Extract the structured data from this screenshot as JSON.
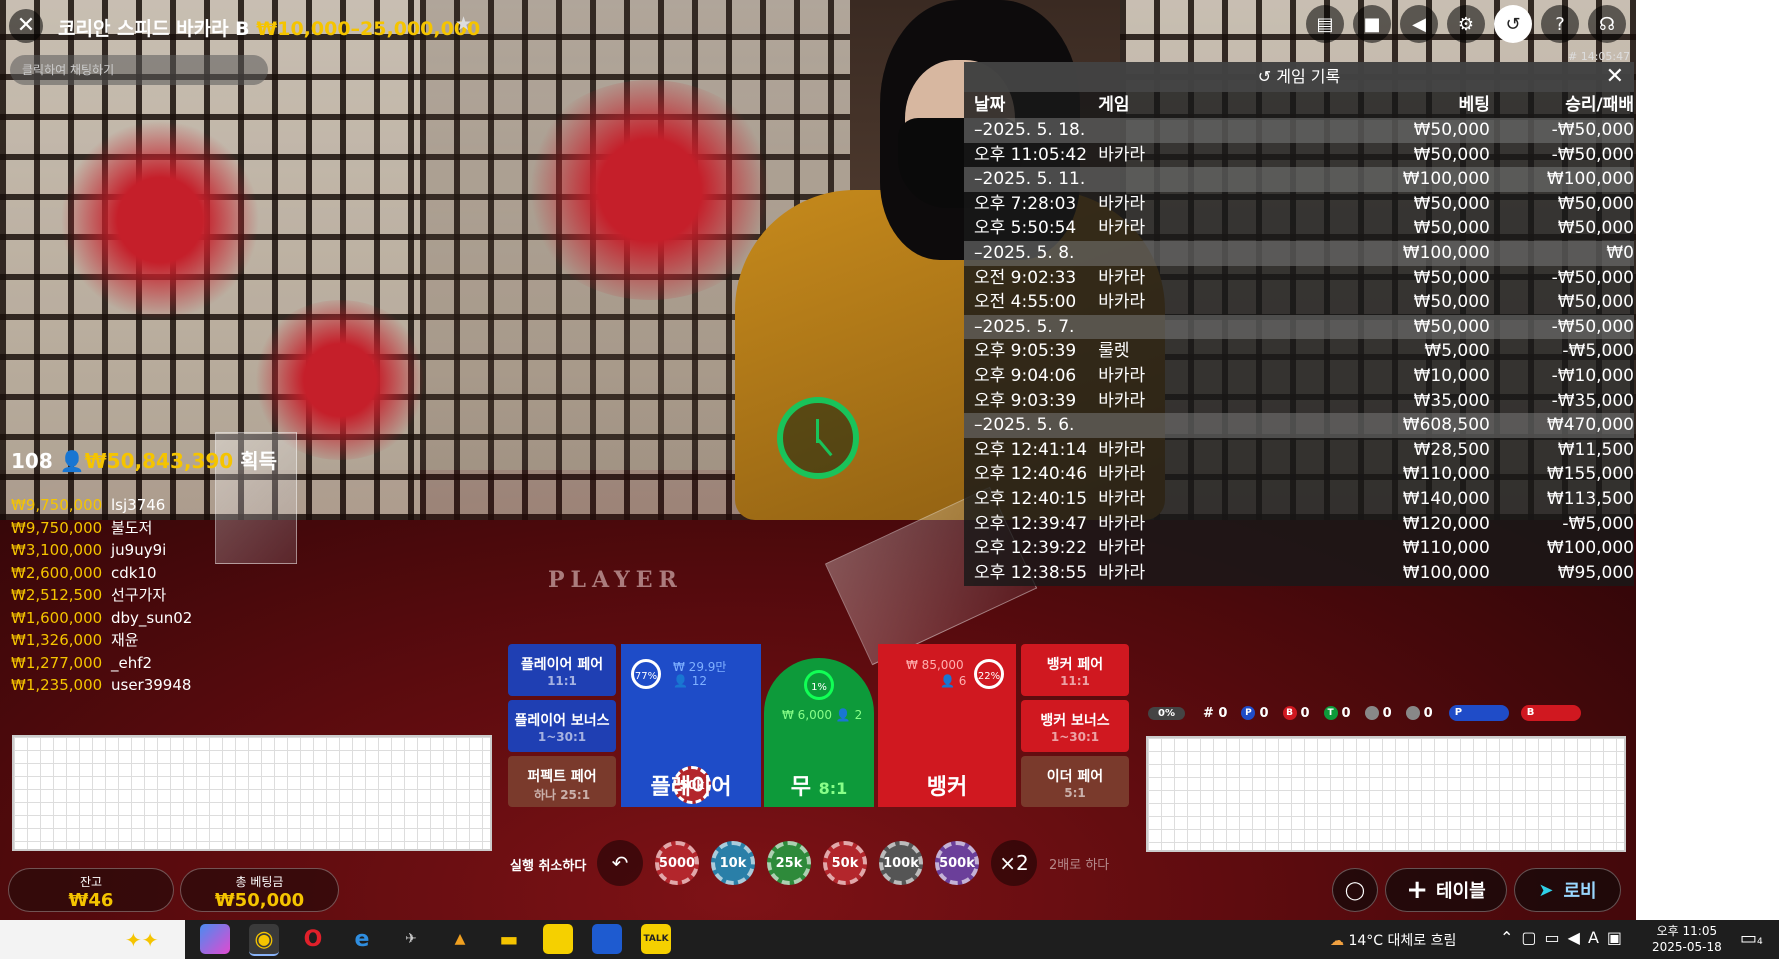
{
  "header": {
    "close_icon": "close-icon",
    "title": "코리안 스피드 바카라 B",
    "limits": "₩10,000–25,000,000",
    "chat_placeholder": "클릭하여 채팅하기",
    "clock": "# 14:05:47",
    "icons": [
      "chat-icon",
      "video-icon",
      "volume-icon",
      "gear-icon",
      "history-icon",
      "help-icon",
      "headset-icon"
    ]
  },
  "history": {
    "title": "게임 기록",
    "columns": [
      "날짜",
      "게임",
      "베팅",
      "승리/패배"
    ],
    "rows": [
      {
        "date": "–2025. 5. 18.",
        "game": "",
        "bet": "₩50,000",
        "result": "-₩50,000",
        "group": true
      },
      {
        "date": "오후 11:05:42",
        "game": "바카라",
        "bet": "₩50,000",
        "result": "-₩50,000"
      },
      {
        "date": "–2025. 5. 11.",
        "game": "",
        "bet": "₩100,000",
        "result": "₩100,000",
        "group": true
      },
      {
        "date": "오후 7:28:03",
        "game": "바카라",
        "bet": "₩50,000",
        "result": "₩50,000"
      },
      {
        "date": "오후 5:50:54",
        "game": "바카라",
        "bet": "₩50,000",
        "result": "₩50,000"
      },
      {
        "date": "–2025. 5. 8.",
        "game": "",
        "bet": "₩100,000",
        "result": "₩0",
        "group": true
      },
      {
        "date": "오전 9:02:33",
        "game": "바카라",
        "bet": "₩50,000",
        "result": "-₩50,000"
      },
      {
        "date": "오전 4:55:00",
        "game": "바카라",
        "bet": "₩50,000",
        "result": "₩50,000"
      },
      {
        "date": "–2025. 5. 7.",
        "game": "",
        "bet": "₩50,000",
        "result": "-₩50,000",
        "group": true
      },
      {
        "date": "오후 9:05:39",
        "game": "룰렛",
        "bet": "₩5,000",
        "result": "-₩5,000"
      },
      {
        "date": "오후 9:04:06",
        "game": "바카라",
        "bet": "₩10,000",
        "result": "-₩10,000"
      },
      {
        "date": "오후 9:03:39",
        "game": "바카라",
        "bet": "₩35,000",
        "result": "-₩35,000"
      },
      {
        "date": "–2025. 5. 6.",
        "game": "",
        "bet": "₩608,500",
        "result": "₩470,000",
        "group": true
      },
      {
        "date": "오후 12:41:14",
        "game": "바카라",
        "bet": "₩28,500",
        "result": "₩11,500"
      },
      {
        "date": "오후 12:40:46",
        "game": "바카라",
        "bet": "₩110,000",
        "result": "₩155,000"
      },
      {
        "date": "오후 12:40:15",
        "game": "바카라",
        "bet": "₩140,000",
        "result": "₩113,500"
      },
      {
        "date": "오후 12:39:47",
        "game": "바카라",
        "bet": "₩120,000",
        "result": "-₩5,000"
      },
      {
        "date": "오후 12:39:22",
        "game": "바카라",
        "bet": "₩110,000",
        "result": "₩100,000"
      },
      {
        "date": "오후 12:38:55",
        "game": "바카라",
        "bet": "₩100,000",
        "result": "₩95,000"
      }
    ]
  },
  "scene": {
    "table_label": "PLAYER"
  },
  "winners": {
    "count": "108",
    "total": "₩50,843,390",
    "suffix": "획득",
    "list": [
      {
        "amount": "₩9,750,000",
        "name": "lsj3746"
      },
      {
        "amount": "₩9,750,000",
        "name": "불도저"
      },
      {
        "amount": "₩3,100,000",
        "name": "ju9uy9i"
      },
      {
        "amount": "₩2,600,000",
        "name": "cdk10"
      },
      {
        "amount": "₩2,512,500",
        "name": "선구가자"
      },
      {
        "amount": "₩1,600,000",
        "name": "dby_sun02"
      },
      {
        "amount": "₩1,326,000",
        "name": "재윤"
      },
      {
        "amount": "₩1,277,000",
        "name": "_ehf2"
      },
      {
        "amount": "₩1,235,000",
        "name": "user39948"
      }
    ]
  },
  "bets": {
    "player_pair": {
      "label": "플레이어 페어",
      "odds": "11:1"
    },
    "player_bonus": {
      "label": "플레이어 보너스",
      "odds": "1~30:1"
    },
    "perfect_pair": {
      "label": "퍼펙트 페어",
      "odds": "하나 25:1"
    },
    "banker_pair": {
      "label": "뱅커 페어",
      "odds": "11:1"
    },
    "banker_bonus": {
      "label": "뱅커 보너스",
      "odds": "1~30:1"
    },
    "either_pair": {
      "label": "이더 페어",
      "odds": "5:1"
    },
    "player": {
      "label": "플레이어",
      "pct": "77%",
      "amount": "₩ 29.9만",
      "players": "12",
      "chip": "50k"
    },
    "tie": {
      "label": "무",
      "odds": "8:1",
      "pct": "1%",
      "amount": "₩ 6,000",
      "players": "2"
    },
    "banker": {
      "label": "뱅커",
      "pct": "22%",
      "amount": "₩ 85,000",
      "players": "6"
    }
  },
  "controls": {
    "undo_label": "실행 취소하다",
    "chips": [
      "5000",
      "10k",
      "25k",
      "50k",
      "100k",
      "500k"
    ],
    "chip_colors": [
      "#b3262c",
      "#2a7fa8",
      "#2e8a3a",
      "#b3262c",
      "#555555",
      "#6b3f9a"
    ],
    "double_icon": "×2",
    "double_label": "2배로 하다"
  },
  "stats": {
    "progress": "0%",
    "hash": "# 0",
    "p": "0",
    "b": "0",
    "t": "0",
    "pp": "0",
    "bp": "0",
    "bar_p": "P",
    "bar_b": "B"
  },
  "footer": {
    "balance_label": "잔고",
    "balance": "₩46",
    "total_bet_label": "총 베팅금",
    "total_bet": "₩50,000",
    "add_table": "테이블",
    "lobby": "로비"
  },
  "taskbar": {
    "weather": "14°C 대체로 흐림",
    "time": "오후 11:05",
    "date": "2025-05-18",
    "notifications": "4",
    "apps": [
      "copilot-icon",
      "chrome-icon",
      "opera-icon",
      "edge-icon",
      "app-icon",
      "app-icon",
      "folder-icon",
      "notes-icon",
      "app-icon",
      "kakaotalk-icon"
    ]
  }
}
